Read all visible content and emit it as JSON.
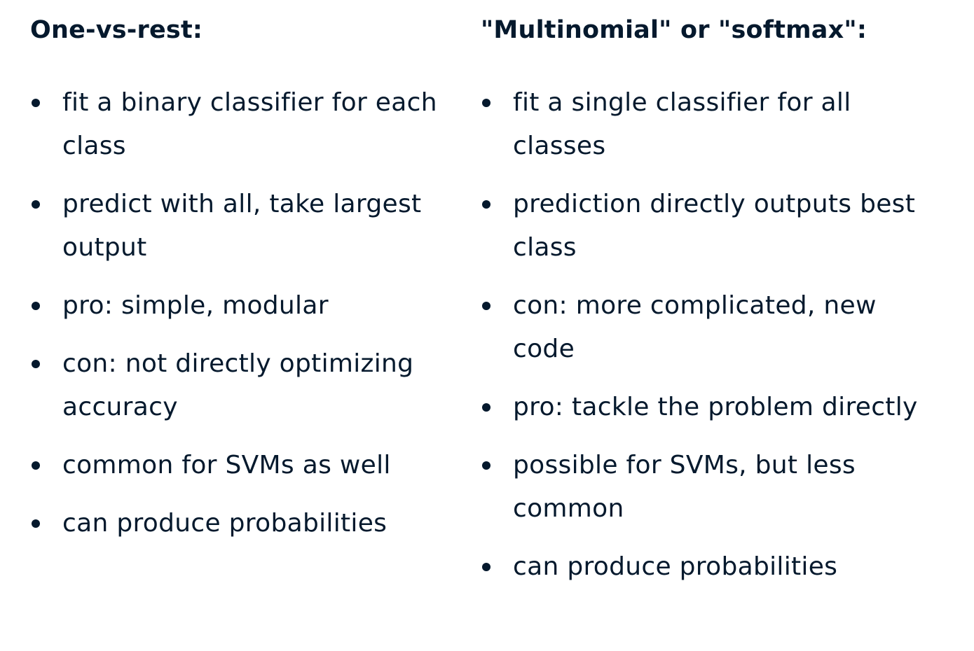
{
  "left": {
    "heading": "One-vs-rest:",
    "items": [
      "fit a binary classifier for each class",
      "predict with all, take largest output",
      "pro: simple, modular",
      "con: not directly optimizing accuracy",
      "common for SVMs as well",
      "can produce probabilities"
    ]
  },
  "right": {
    "heading": "\"Multinomial\" or \"softmax\":",
    "items": [
      "fit a single classifier for all classes",
      "prediction directly outputs best class",
      "con: more complicated, new code",
      "pro: tackle the problem directly",
      "possible for SVMs, but less common",
      "can produce probabilities"
    ]
  },
  "colors": {
    "text": "#05192d",
    "background": "#ffffff"
  }
}
